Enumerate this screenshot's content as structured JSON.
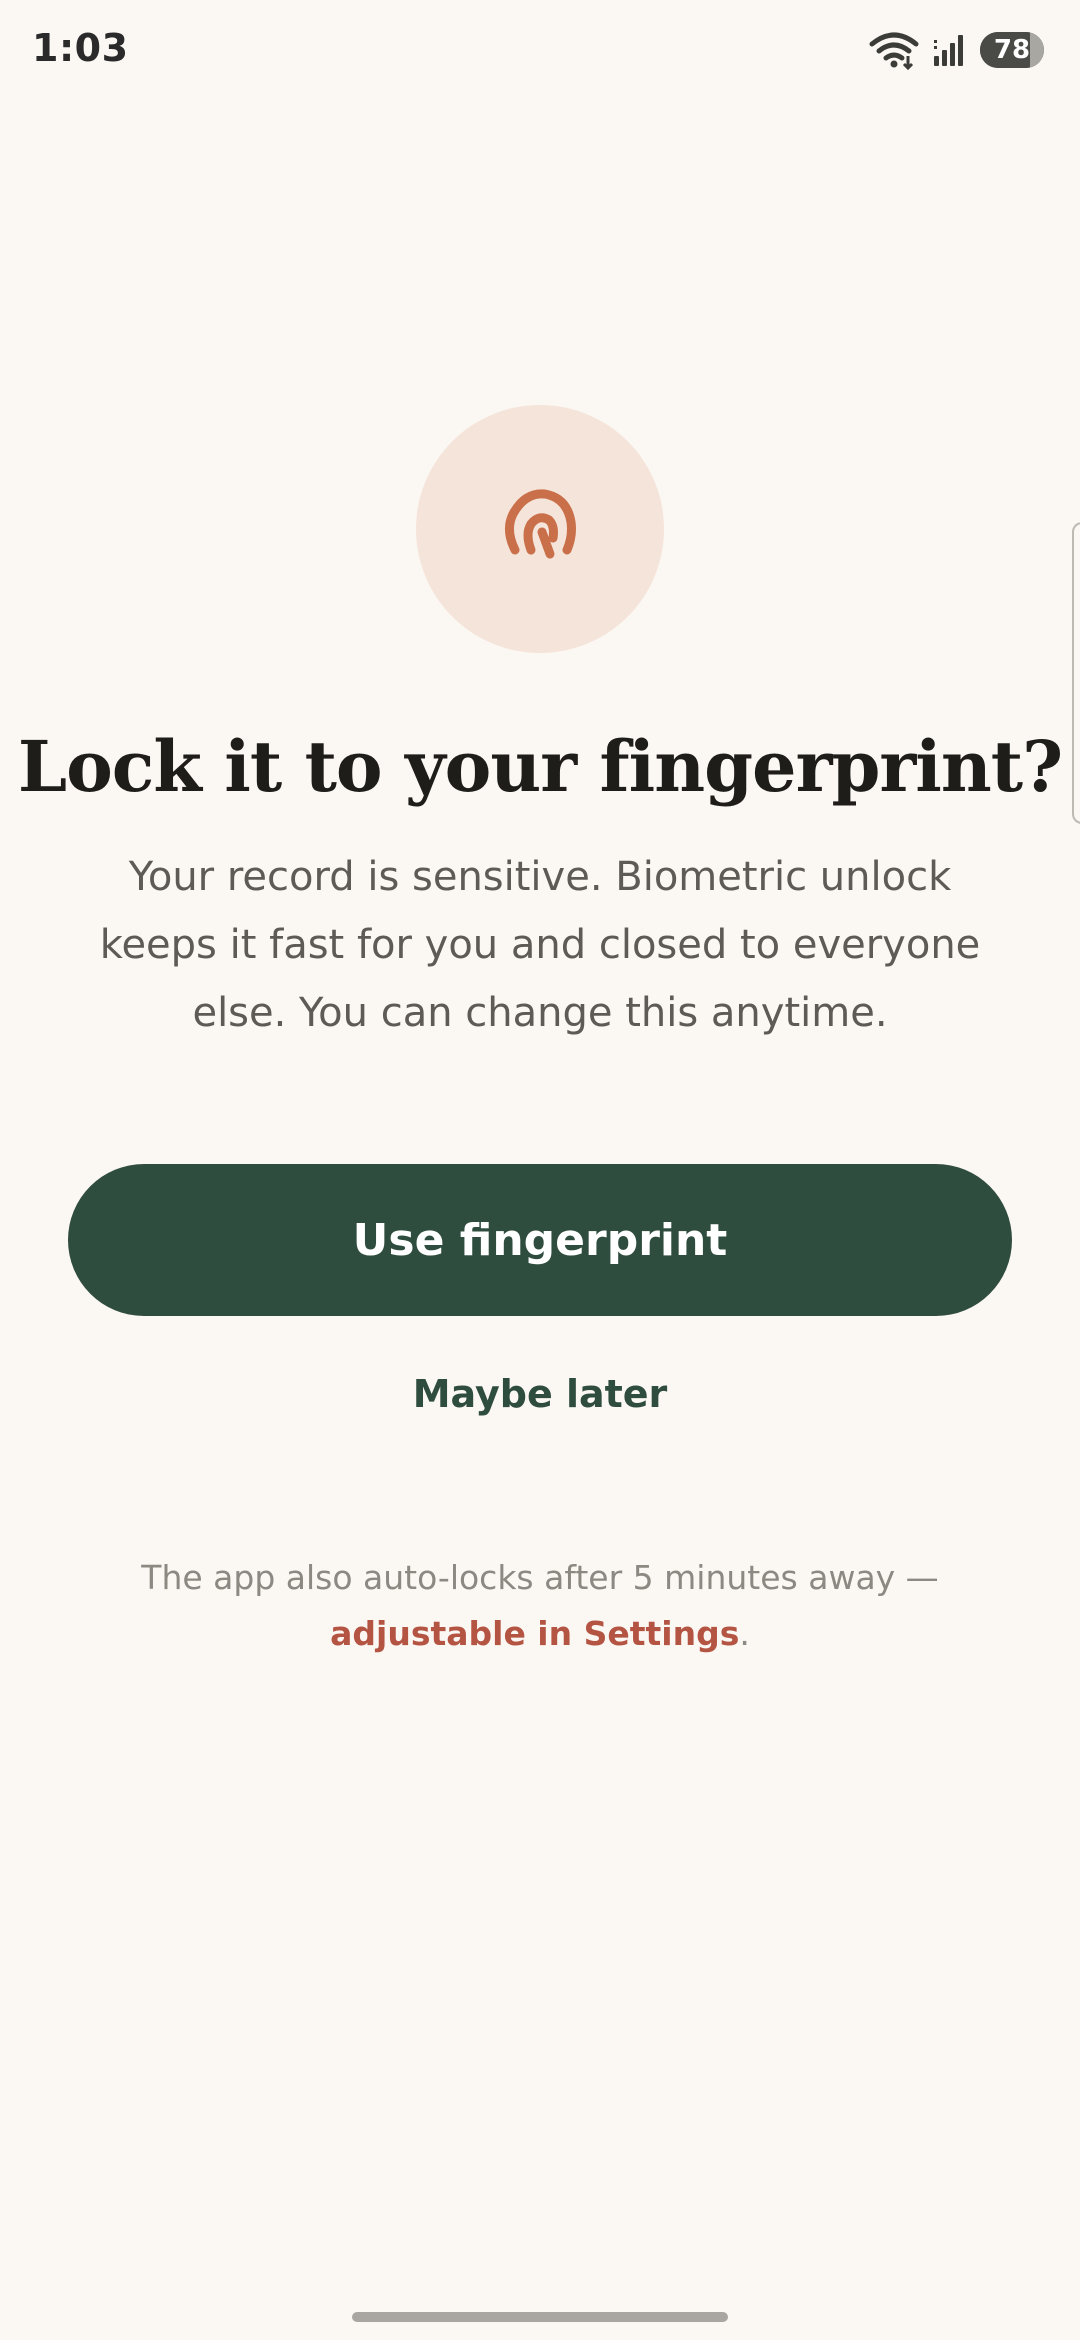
{
  "status_bar": {
    "time": "1:03",
    "battery_percent": 78,
    "battery_label": "78",
    "icons": [
      "wifi-icon",
      "cellular-signal-icon",
      "battery-icon"
    ]
  },
  "hero": {
    "icon": "fingerprint-icon",
    "circle_color": "#F5E4D9",
    "icon_color": "#C9704A"
  },
  "content": {
    "headline": "Lock it to your fingerprint?",
    "body": "Your record is sensitive. Biometric unlock keeps it fast for you and closed to everyone else. You can change this anytime."
  },
  "actions": {
    "primary_label": "Use fingerprint",
    "secondary_label": "Maybe later"
  },
  "footnote": {
    "text_before": "The app also auto-locks after 5 minutes away — ",
    "link_text": "adjustable in Settings",
    "text_after": "."
  },
  "colors": {
    "background": "#FBF7F2",
    "primary": "#2F4D3E",
    "accent": "#B45443"
  }
}
